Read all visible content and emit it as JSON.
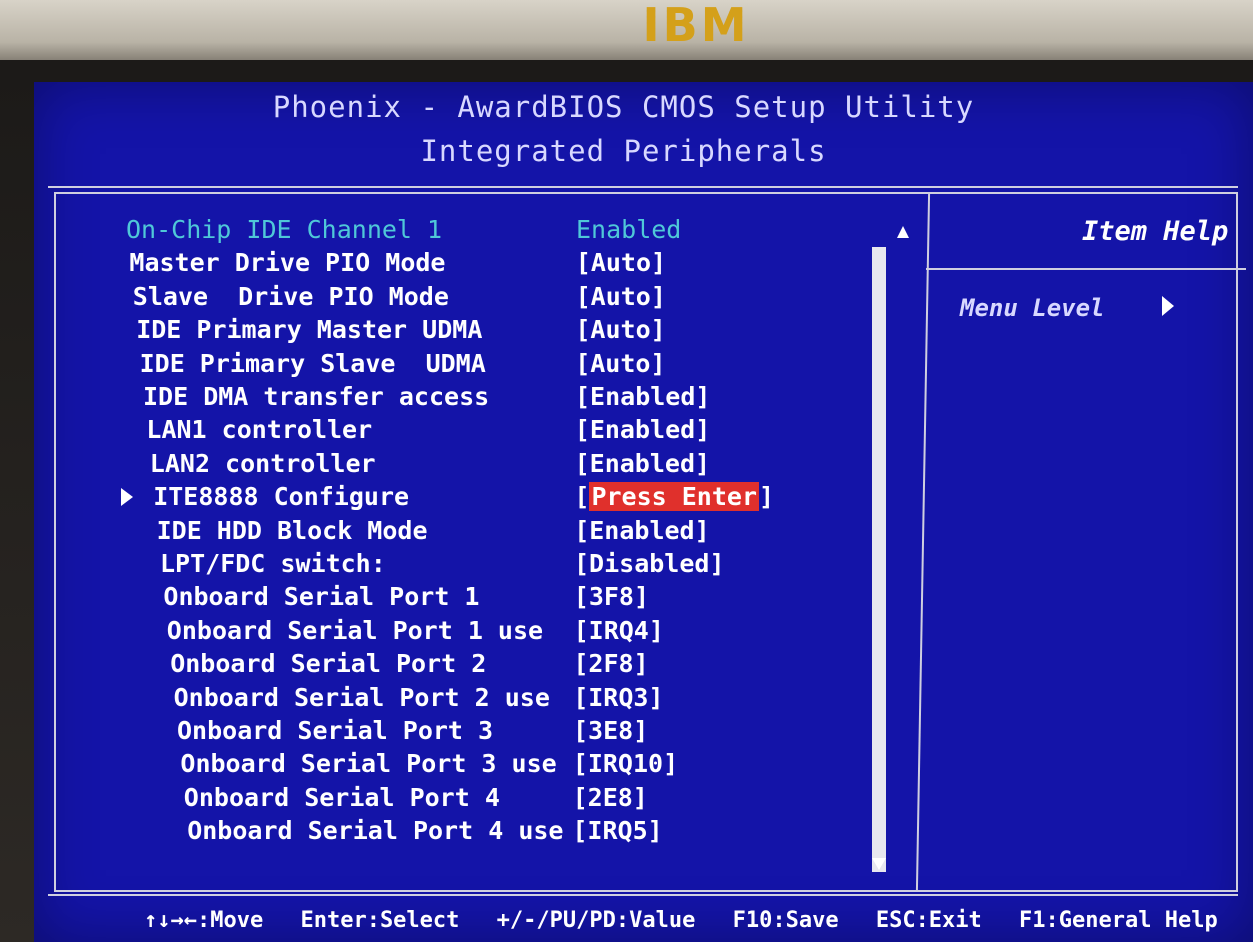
{
  "brand": {
    "logo_text": "IBM"
  },
  "header": {
    "title": "Phoenix - AwardBIOS CMOS Setup Utility",
    "subtitle": "Integrated Peripherals"
  },
  "help_panel": {
    "title": "Item Help",
    "menu_level": "Menu Level"
  },
  "settings": [
    {
      "label": "On-Chip IDE Channel 1",
      "value": "Enabled",
      "style": "cyan"
    },
    {
      "label": "Master Drive PIO Mode",
      "value": "[Auto]"
    },
    {
      "label": "Slave  Drive PIO Mode",
      "value": "[Auto]"
    },
    {
      "label": "IDE Primary Master UDMA",
      "value": "[Auto]"
    },
    {
      "label": "IDE Primary Slave  UDMA",
      "value": "[Auto]"
    },
    {
      "label": "IDE DMA transfer access",
      "value": "[Enabled]"
    },
    {
      "label": "LAN1 controller",
      "value": "[Enabled]"
    },
    {
      "label": "LAN2 controller",
      "value": "[Enabled]"
    },
    {
      "label": "ITE8888 Configure",
      "value_prefix": "[",
      "value": "Press Enter",
      "value_suffix": "]",
      "submenu": true,
      "selected": true
    },
    {
      "label": "IDE HDD Block Mode",
      "value": "[Enabled]"
    },
    {
      "label": "LPT/FDC switch:",
      "value": "[Disabled]"
    },
    {
      "label": "Onboard Serial Port 1",
      "value": "[3F8]"
    },
    {
      "label": "Onboard Serial Port 1 use",
      "value": "[IRQ4]"
    },
    {
      "label": "Onboard Serial Port 2",
      "value": "[2F8]"
    },
    {
      "label": "Onboard Serial Port 2 use",
      "value": "[IRQ3]"
    },
    {
      "label": "Onboard Serial Port 3",
      "value": "[3E8]"
    },
    {
      "label": "Onboard Serial Port 3 use",
      "value": "[IRQ10]"
    },
    {
      "label": "Onboard Serial Port 4",
      "value": "[2E8]"
    },
    {
      "label": "Onboard Serial Port 4 use",
      "value": "[IRQ5]"
    }
  ],
  "footer": {
    "move": "↑↓→←:Move",
    "select": "Enter:Select",
    "value": "+/-/PU/PD:Value",
    "save": "F10:Save",
    "exit": "ESC:Exit",
    "help": "F1:General Help"
  },
  "colors": {
    "screen_bg": "#1414a8",
    "highlight": "#e0302c",
    "active_row_text": "#4fc8d8",
    "logo": "#d4a01a"
  }
}
